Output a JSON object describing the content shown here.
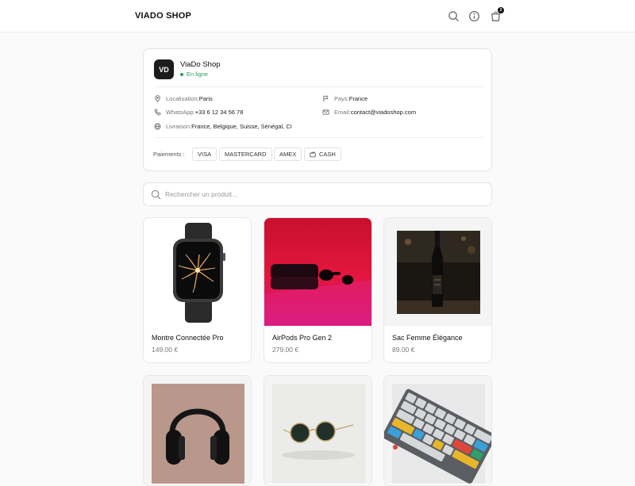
{
  "header": {
    "brand": "VIADO SHOP",
    "cart_count": "2",
    "icons": [
      "search-icon",
      "info-icon",
      "cart-icon"
    ]
  },
  "shop": {
    "initials": "VD",
    "name": "ViaDo Shop",
    "status": "En ligne",
    "status_color": "#2a9d5c",
    "location_label": "Localisation: ",
    "location": "Paris",
    "country_label": "Pays: ",
    "country": "France",
    "whatsapp_label": "WhatsApp: ",
    "whatsapp": "+33 6 12 34 56 78",
    "email_label": "Email: ",
    "email": "contact@viadoshop.com",
    "delivery_label": "Livraison: ",
    "delivery": "France, Belgique, Suisse, Sénégal, CI",
    "payments_label": "Paiements :",
    "payments": [
      "VISA",
      "MASTERCARD",
      "AMEX",
      "CASH"
    ]
  },
  "search": {
    "placeholder": "Rechercher un produit..."
  },
  "products": [
    {
      "name": "Montre Connectée Pro",
      "price": "149.00 €",
      "image": "smartwatch"
    },
    {
      "name": "AirPods Pro Gen 2",
      "price": "279.00 €",
      "image": "earbuds-case-red"
    },
    {
      "name": "Sac Femme Élégance",
      "price": "89.00 €",
      "image": "wine-bottle"
    },
    {
      "name": "",
      "price": "",
      "image": "headphones"
    },
    {
      "name": "",
      "price": "",
      "image": "sunglasses"
    },
    {
      "name": "",
      "price": "",
      "image": "keyboard"
    }
  ]
}
